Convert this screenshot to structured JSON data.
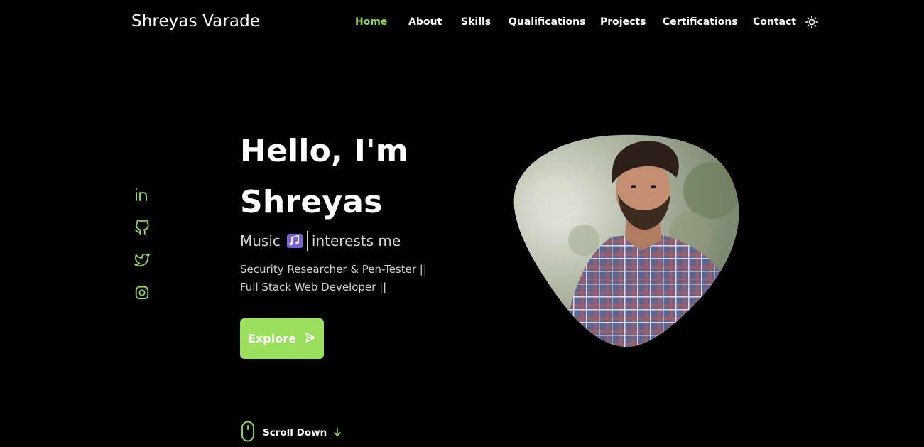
{
  "header": {
    "brand": "Shreyas Varade",
    "nav": [
      {
        "label": "Home",
        "active": true
      },
      {
        "label": "About",
        "active": false
      },
      {
        "label": "Skills",
        "active": false
      },
      {
        "label": "Qualifications",
        "active": false
      },
      {
        "label": "Projects",
        "active": false
      },
      {
        "label": "Certifications",
        "active": false
      },
      {
        "label": "Contact",
        "active": false
      }
    ],
    "theme_icon": "sun-icon"
  },
  "social": [
    {
      "icon": "linkedin-icon"
    },
    {
      "icon": "github-icon"
    },
    {
      "icon": "twitter-icon"
    },
    {
      "icon": "instagram-icon"
    }
  ],
  "hero": {
    "greeting": "Hello, I'm",
    "name": "Shreyas",
    "typed_prefix": "Music",
    "typed_icon": "music-notes-icon",
    "typed_suffix": "interests me",
    "description_line1": "Security Researcher & Pen-Tester ||",
    "description_line2": "Full Stack Web Developer ||",
    "button_label": "Explore",
    "button_icon": "send-icon"
  },
  "scroll": {
    "label": "Scroll Down",
    "mouse_icon": "mouse-icon",
    "arrow_icon": "arrow-down-icon"
  },
  "colors": {
    "accent": "#8fd34f",
    "button": "#9be05c",
    "background": "#000000"
  }
}
